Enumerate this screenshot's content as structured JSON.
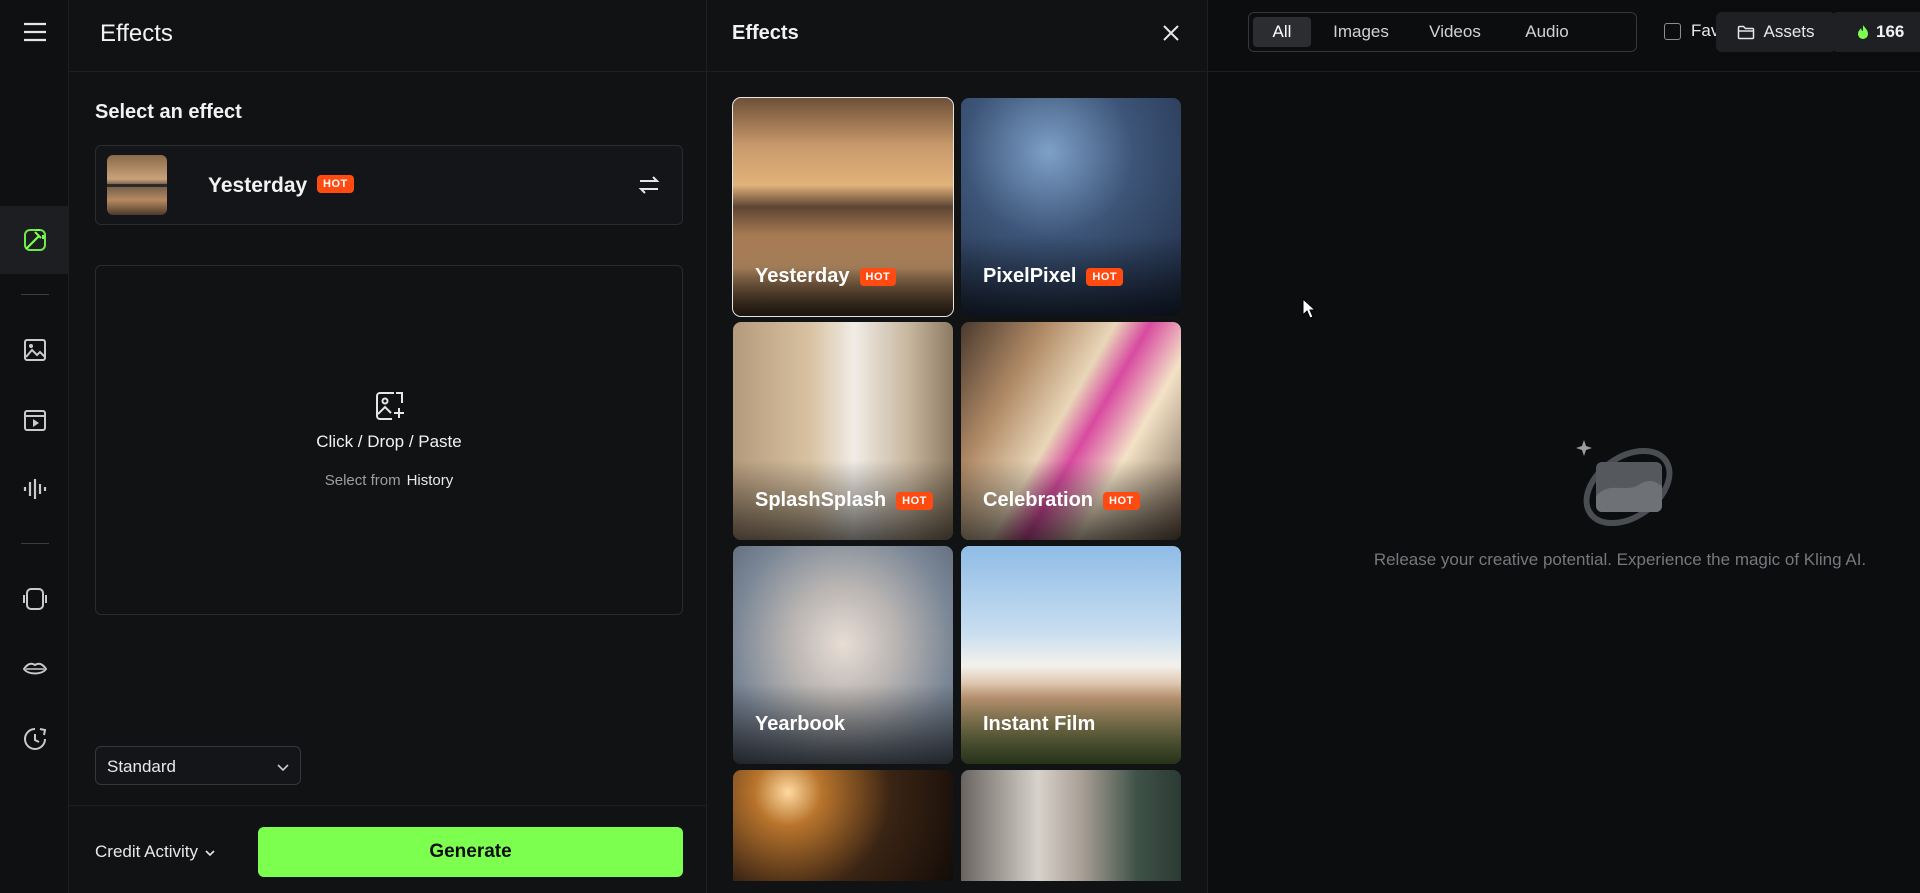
{
  "panel": {
    "title": "Effects",
    "section_title": "Select an effect",
    "selected_effect": {
      "name": "Yesterday",
      "badge": "HOT"
    },
    "dropzone": {
      "primary": "Click / Drop / Paste",
      "secondary_prefix": "Select from",
      "secondary_link": "History"
    },
    "mode": {
      "selected": "Standard"
    },
    "footer": {
      "credit_activity": "Credit Activity",
      "generate": "Generate"
    }
  },
  "gallery": {
    "title": "Effects",
    "cards": [
      {
        "name": "Yesterday",
        "badge": "HOT"
      },
      {
        "name": "PixelPixel",
        "badge": "HOT"
      },
      {
        "name": "SplashSplash",
        "badge": "HOT"
      },
      {
        "name": "Celebration",
        "badge": "HOT"
      },
      {
        "name": "Yearbook",
        "badge": ""
      },
      {
        "name": "Instant Film",
        "badge": ""
      },
      {
        "name": "",
        "badge": ""
      },
      {
        "name": "",
        "badge": ""
      }
    ]
  },
  "workspace": {
    "tabs": [
      "All",
      "Images",
      "Videos",
      "Audio"
    ],
    "favorites": "Favorites",
    "assets": "Assets",
    "credits": "166",
    "empty_message": "Release your creative potential. Experience the magic of Kling AI."
  },
  "colors": {
    "accent": "#7cff4f",
    "hot_badge": "#ff4a12"
  },
  "icons": {
    "rail": [
      "menu-icon",
      "effects-icon",
      "image-icon",
      "video-icon",
      "audio-icon",
      "sound-icon",
      "lip-icon",
      "history-icon"
    ]
  }
}
